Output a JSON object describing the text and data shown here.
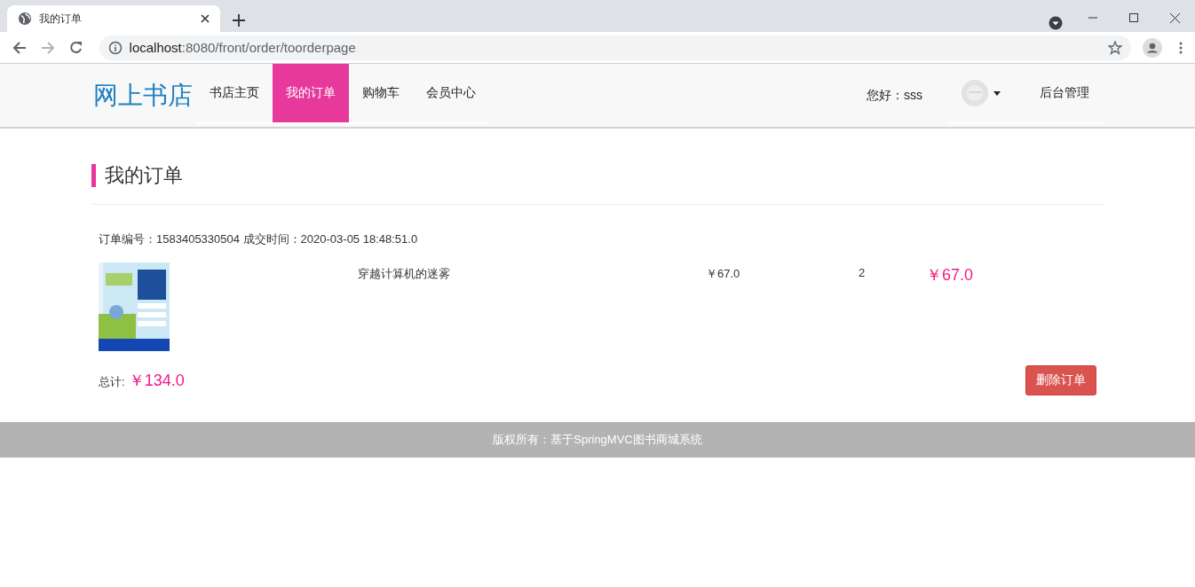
{
  "browser": {
    "tab_title": "我的订单",
    "url_host": "localhost",
    "url_rest": ":8080/front/order/toorderpage"
  },
  "navbar": {
    "brand": "网上书店",
    "items": [
      {
        "label": "书店主页",
        "selected": false
      },
      {
        "label": "我的订单",
        "selected": true
      },
      {
        "label": "购物车",
        "selected": false
      },
      {
        "label": "会员中心",
        "selected": false
      }
    ],
    "greeting": "您好：sss",
    "admin_link": "后台管理"
  },
  "page_title": "我的订单",
  "orders": [
    {
      "info": "订单编号：1583405330504 成交时间：2020-03-05 18:48:51.0",
      "items": [
        {
          "name": "穿越计算机的迷雾",
          "price": "￥67.0",
          "quantity": "2",
          "subtotal": "￥67.0"
        }
      ],
      "total_label": "总计:",
      "total": "￥134.0",
      "delete_button": "删除订单"
    }
  ],
  "footer": "版权所有：基于SpringMVC图书商城系统"
}
